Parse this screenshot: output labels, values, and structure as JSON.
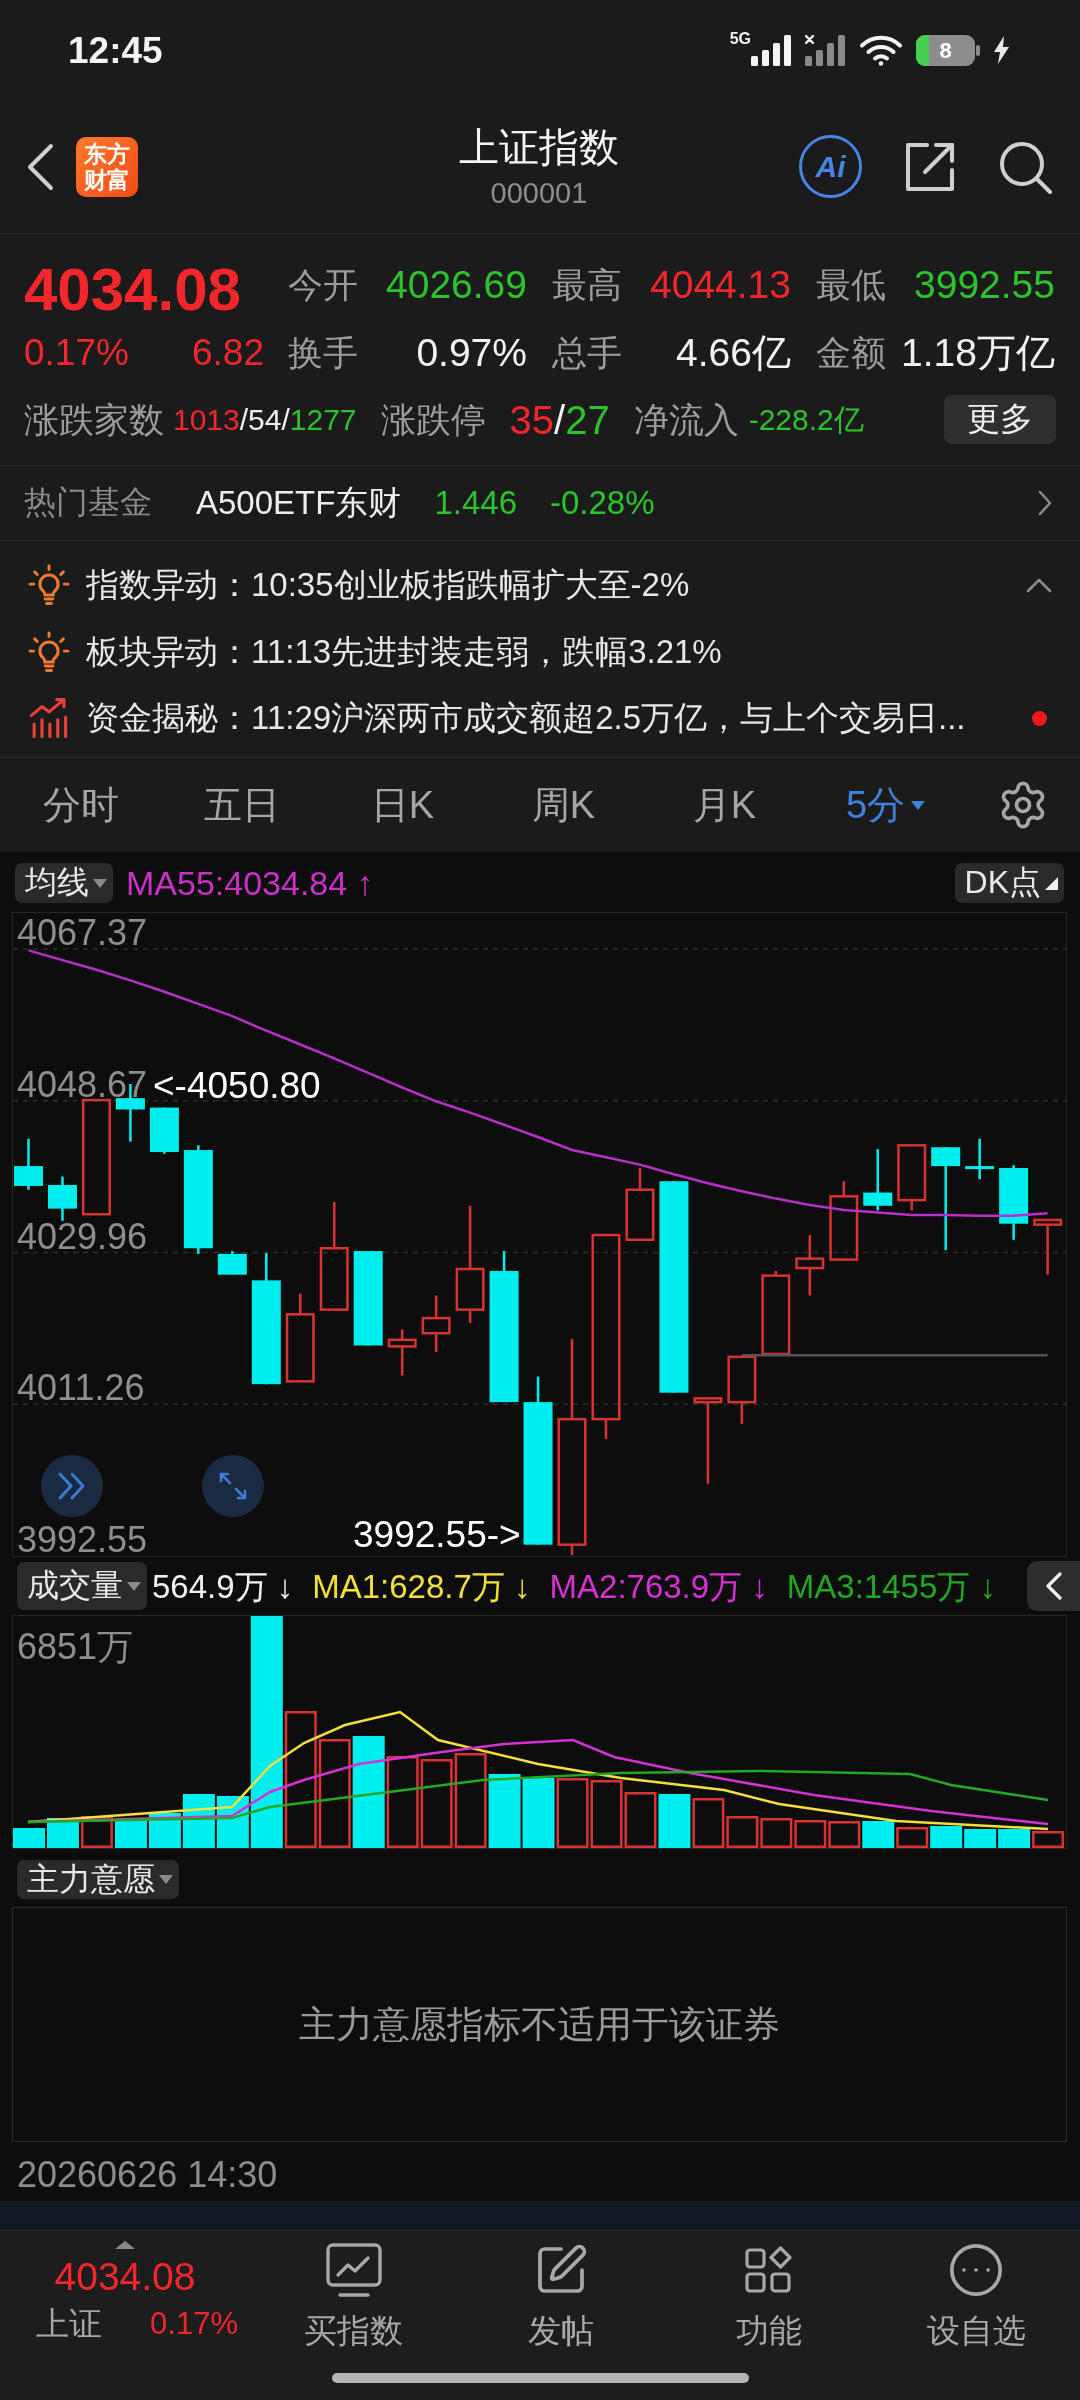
{
  "status_bar": {
    "time": "12:45",
    "network": "5G",
    "battery": "8"
  },
  "header": {
    "logo": "东方财富",
    "title": "上证指数",
    "code": "000001",
    "ai_label": "Ai"
  },
  "quote": {
    "price": "4034.08",
    "change_pct": "0.17%",
    "change": "6.82",
    "rising": true,
    "stats": [
      {
        "label": "今开",
        "value": "4026.69",
        "color": "#2bc52b"
      },
      {
        "label": "最高",
        "value": "4044.13",
        "color": "#f2262b"
      },
      {
        "label": "最低",
        "value": "3992.55",
        "color": "#2bc52b"
      },
      {
        "label": "换手",
        "value": "0.97%",
        "color": "#f2f2f2"
      },
      {
        "label": "总手",
        "value": "4.66亿",
        "color": "#f2f2f2"
      },
      {
        "label": "金额",
        "value": "1.18万亿",
        "color": "#f2f2f2"
      }
    ],
    "breadth": {
      "label": "涨跌家数",
      "value": "1013/54/1277"
    },
    "limits": {
      "label": "涨跌停",
      "value": "35/27"
    },
    "net_inflow": {
      "label": "净流入",
      "value": "-228.2亿",
      "rising": false
    },
    "more_button": "更多"
  },
  "hot_fund": {
    "label": "热门基金",
    "name": "A500ETF东财",
    "price": "1.446",
    "change": "-0.28%",
    "rising": false
  },
  "news": {
    "expanded": true,
    "items": [
      {
        "kind": "alert",
        "text": "指数异动：10:35创业板指跌幅扩大至-2%",
        "unread": false
      },
      {
        "kind": "alert",
        "text": "板块异动：11:13先进封装走弱，跌幅3.21%",
        "unread": false
      },
      {
        "kind": "capital",
        "text": "资金揭秘：11:29沪深两市成交额超2.5万亿，与上个交易日...",
        "unread": true
      }
    ]
  },
  "tabs": [
    {
      "label": "分时",
      "selected": false,
      "kind": "plain"
    },
    {
      "label": "五日",
      "selected": false,
      "kind": "plain"
    },
    {
      "label": "日K",
      "selected": false,
      "kind": "plain"
    },
    {
      "label": "周K",
      "selected": false,
      "kind": "plain"
    },
    {
      "label": "月K",
      "selected": false,
      "kind": "plain"
    },
    {
      "label": "5分",
      "selected": true,
      "kind": "dropdown"
    }
  ],
  "chart": {
    "overlay_chip": "均线",
    "ma_reading": "MA55:4034.84 ↑",
    "dk_chip": "DK点",
    "high_marker": "<-4050.80",
    "low_marker": "3992.55->",
    "chart_data": {
      "type": "line",
      "ylim": [
        3992.55,
        4067.37
      ],
      "yticks": [
        4067.37,
        4048.67,
        4029.96,
        4011.26,
        3992.55
      ],
      "grid": true,
      "series": [
        {
          "color": "#b82fc9",
          "values": [
            4067.2,
            4066.0,
            4064.8,
            4063.5,
            4062.1,
            4060.6,
            4059.1,
            4057.3,
            4055.6,
            4053.9,
            4052.1,
            4050.3,
            4048.6,
            4047.2,
            4045.7,
            4044.2,
            4042.6,
            4041.7,
            4040.8,
            4039.6,
            4038.5,
            4037.5,
            4036.6,
            4035.8,
            4035.2,
            4034.9,
            4034.6,
            4034.6,
            4034.5,
            4034.5,
            4034.8
          ]
        },
        {
          "color": "#555555",
          "values": [
            null,
            null,
            null,
            null,
            null,
            null,
            null,
            null,
            null,
            null,
            null,
            null,
            null,
            null,
            null,
            null,
            null,
            null,
            null,
            null,
            null,
            4017.3,
            4017.3,
            4017.3,
            4017.3,
            4017.3,
            4017.3,
            4017.3,
            4017.3,
            4017.3,
            4017.3
          ]
        }
      ]
    }
  },
  "volume": {
    "chip": "成交量",
    "readings": [
      {
        "text": "564.9万 ↓",
        "color": "#f2f2f2"
      },
      {
        "text": "MA1:628.7万 ↓",
        "color": "#f3e03a"
      },
      {
        "text": "MA2:763.9万 ↓",
        "color": "#d630d6"
      },
      {
        "text": "MA3:1455万 ↓",
        "color": "#23a823"
      }
    ],
    "y_label": "6851万"
  },
  "main_force": {
    "chip": "主力意愿",
    "message": "主力意愿指标不适用于该证券"
  },
  "timestamp": "20260626 14:30",
  "bottom_nav": {
    "index": {
      "price": "4034.08",
      "name": "上证",
      "change_pct": "0.17%",
      "rising": true
    },
    "items": [
      {
        "kind": "buy",
        "label": "买指数"
      },
      {
        "kind": "post",
        "label": "发帖"
      },
      {
        "kind": "functions",
        "label": "功能"
      },
      {
        "kind": "watchlist",
        "label": "设自选"
      }
    ]
  }
}
